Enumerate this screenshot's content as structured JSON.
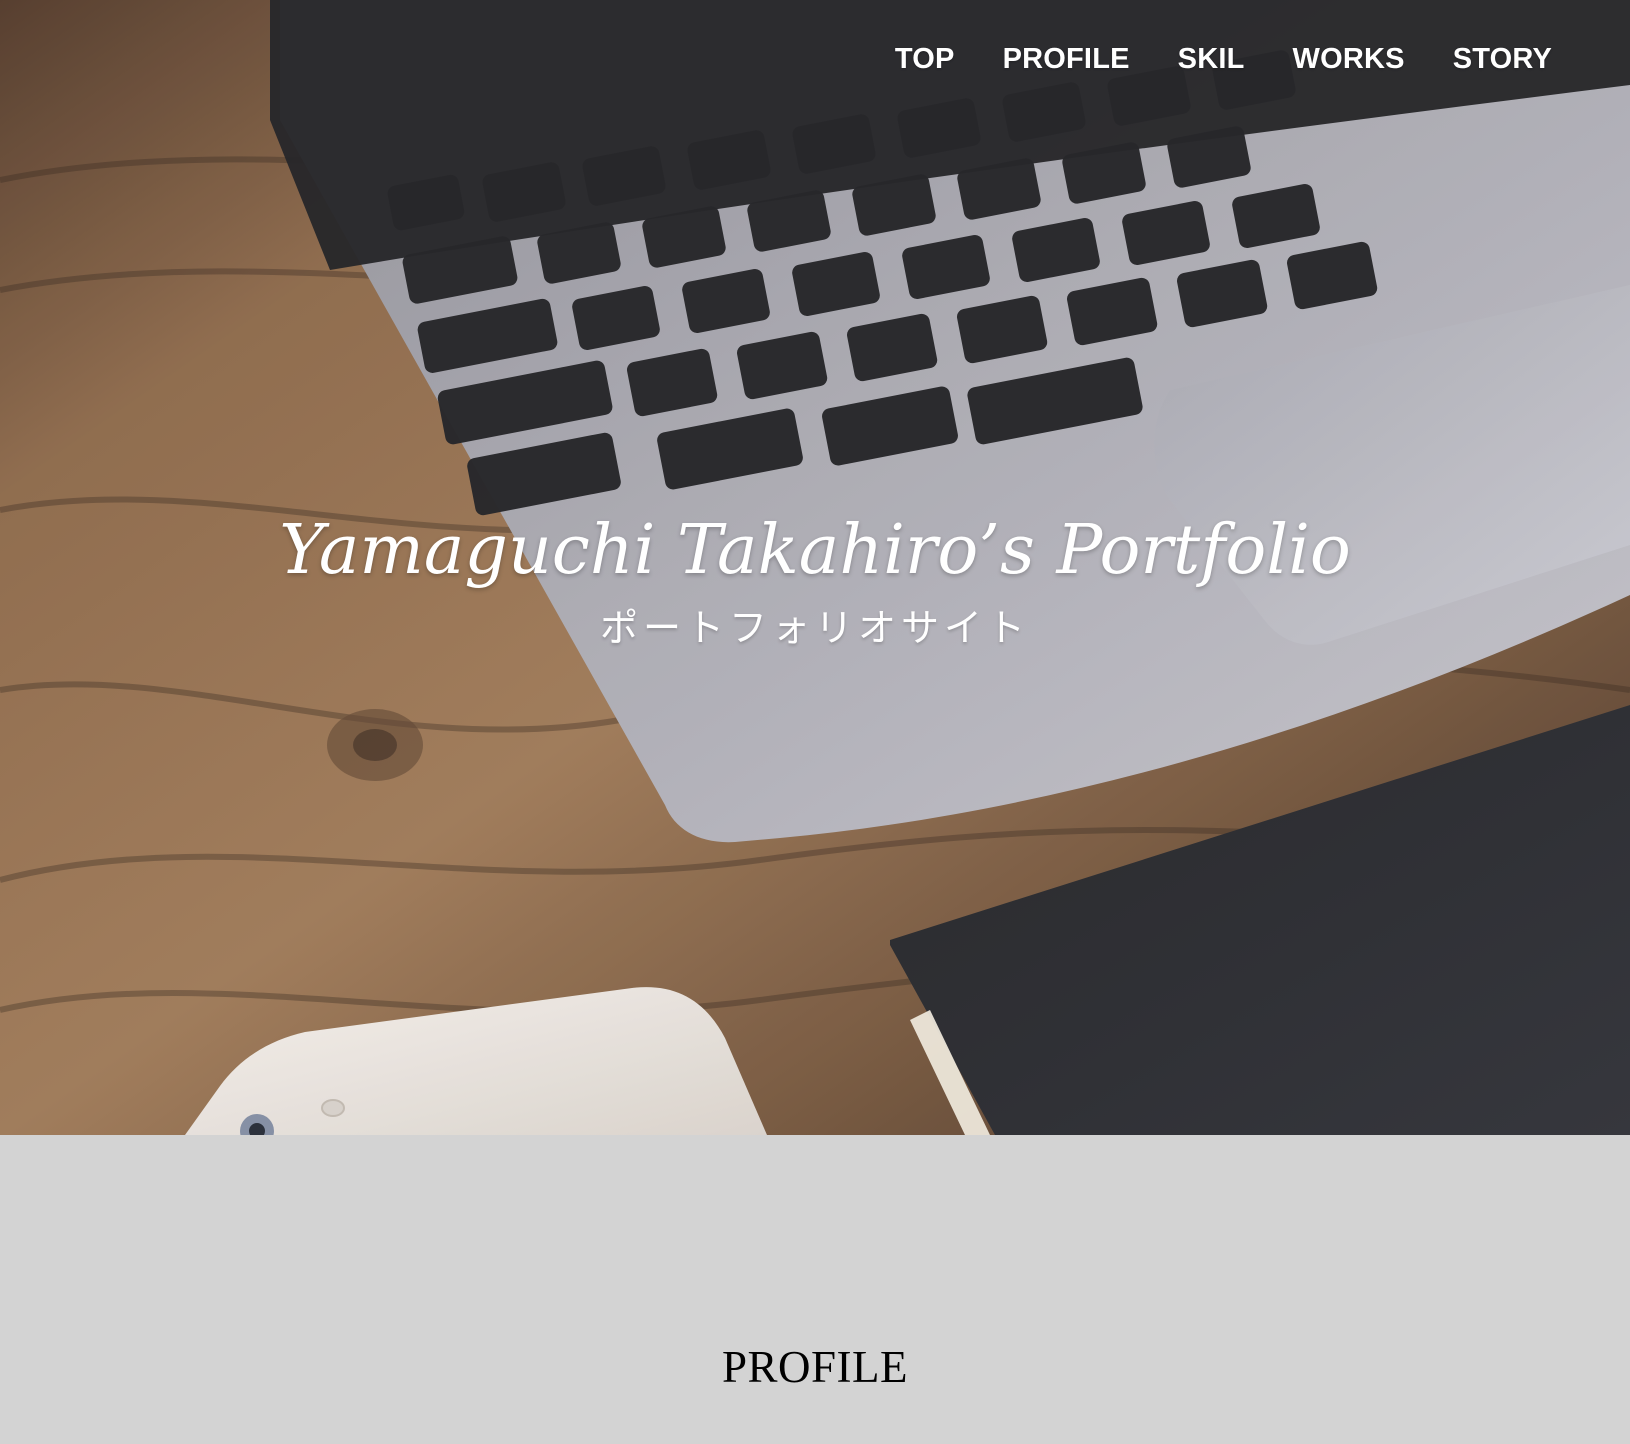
{
  "nav": {
    "items": [
      "TOP",
      "PROFILE",
      "SKIL",
      "WORKS",
      "STORY"
    ]
  },
  "hero": {
    "title": "Yamaguchi Takahiro’s Portfolio",
    "subtitle": "ポートフォリオサイト"
  },
  "profile": {
    "title": "PROFILE"
  }
}
